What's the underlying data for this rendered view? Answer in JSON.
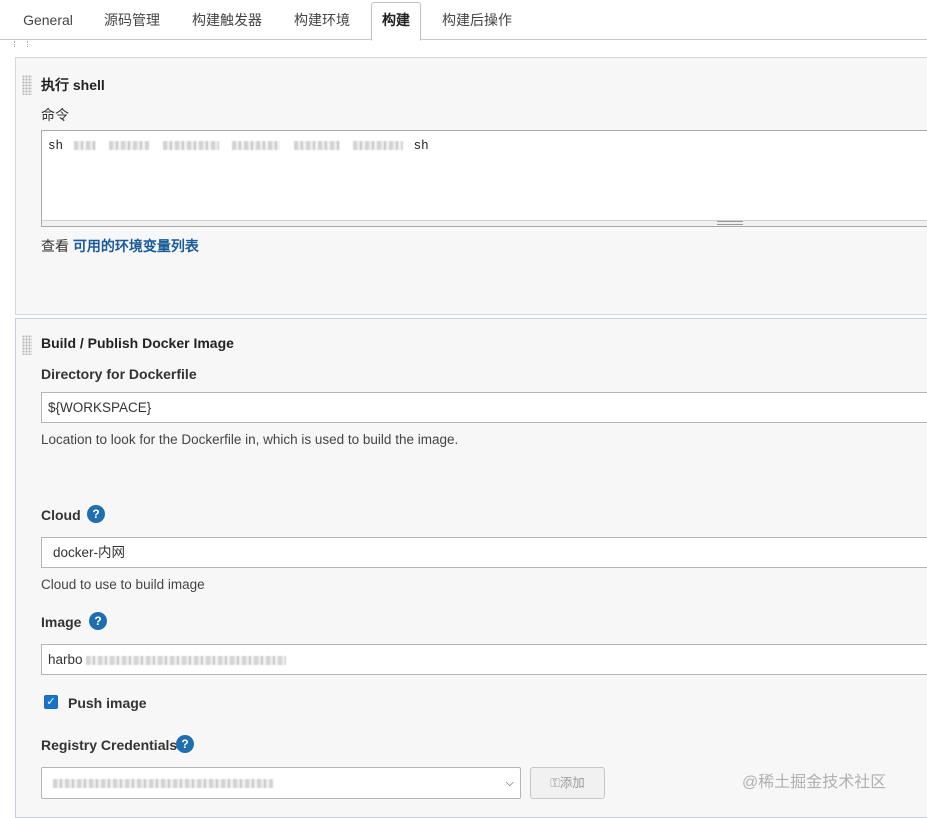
{
  "tabs": [
    {
      "label": "General",
      "active": false
    },
    {
      "label": "源码管理",
      "active": false
    },
    {
      "label": "构建触发器",
      "active": false
    },
    {
      "label": "构建环境",
      "active": false
    },
    {
      "label": "构建",
      "active": true
    },
    {
      "label": "构建后操作",
      "active": false
    }
  ],
  "shell": {
    "title": "执行 shell",
    "command_label": "命令",
    "command_prefix": "sh",
    "command_suffix": "sh",
    "env_prefix": "查看",
    "env_link": "可用的环境变量列表"
  },
  "docker": {
    "title": "Build / Publish Docker Image",
    "dir_label": "Directory for Dockerfile",
    "dir_value": "${WORKSPACE}",
    "dir_desc": "Location to look for the Dockerfile in, which is used to build the image.",
    "cloud_label": "Cloud",
    "cloud_value": "docker-内网",
    "cloud_desc": "Cloud to use to build image",
    "image_label": "Image",
    "image_value": "harbo",
    "push_label": "Push image",
    "push_checked": true,
    "registry_label": "Registry Credentials",
    "add_label": "添加",
    "help_glyph": "?"
  },
  "watermark": "@稀土掘金技术社区"
}
